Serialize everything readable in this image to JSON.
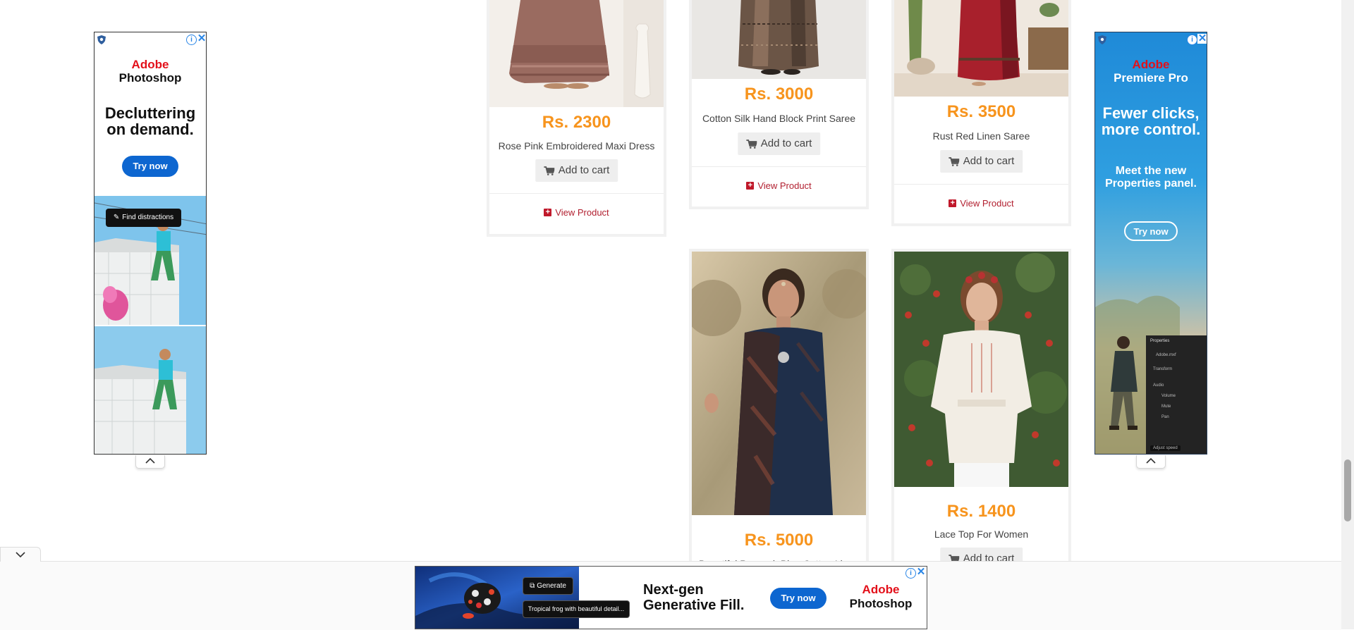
{
  "products": [
    {
      "id": "p1",
      "price": "Rs. 2300",
      "name": "Rose Pink Embroidered Maxi Dress",
      "cart_label": "Add to cart",
      "view_label": "View Product"
    },
    {
      "id": "p2",
      "price": "Rs. 3000",
      "name": "Cotton Silk Hand Block Print Saree",
      "cart_label": "Add to cart",
      "view_label": "View Product"
    },
    {
      "id": "p3",
      "price": "Rs. 3500",
      "name": "Rust Red Linen Saree",
      "cart_label": "Add to cart",
      "view_label": "View Product"
    },
    {
      "id": "p4",
      "price": "Rs. 5000",
      "name": "Beautiful Peacock Blue Cotton Linen"
    },
    {
      "id": "p5",
      "price": "Rs. 1400",
      "name": "Lace Top For Women",
      "cart_label": "Add to cart"
    }
  ],
  "ads": {
    "left": {
      "brand_line1": "Adobe",
      "brand_line2": "Photoshop",
      "headline": "Decluttering on demand.",
      "cta": "Try now",
      "chip": "Find distractions"
    },
    "right": {
      "brand_line1": "Adobe",
      "brand_line2": "Premiere Pro",
      "headline": "Fewer clicks, more control.",
      "subhead": "Meet the new Properties panel.",
      "cta": "Try now",
      "panel_title": "Properties",
      "panel_file": "Adobe.mxf",
      "panel_items": [
        "Transform",
        "Audio",
        "Volume",
        "Mute",
        "Pan"
      ],
      "panel_footer": "Adjust speed"
    },
    "bottom": {
      "generate_label": "Generate",
      "prompt_text": "Tropical frog with beautiful detail...",
      "headline_line1": "Next-gen",
      "headline_line2": "Generative Fill.",
      "cta": "Try now",
      "brand_line1": "Adobe",
      "brand_line2": "Photoshop"
    }
  },
  "colors": {
    "price": "#f7941d",
    "view_link": "#b22030",
    "ad_blue": "#0d66d0",
    "adobe_red": "#e3101a"
  }
}
